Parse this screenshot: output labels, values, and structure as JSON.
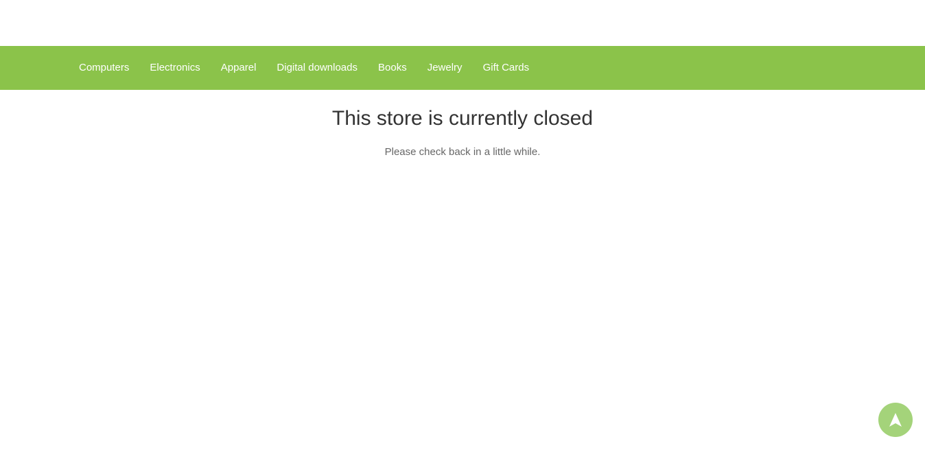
{
  "nav": {
    "items": [
      {
        "label": "Computers"
      },
      {
        "label": "Electronics"
      },
      {
        "label": "Apparel"
      },
      {
        "label": "Digital downloads"
      },
      {
        "label": "Books"
      },
      {
        "label": "Jewelry"
      },
      {
        "label": "Gift Cards"
      }
    ]
  },
  "main": {
    "title": "This store is currently closed",
    "message": "Please check back in a little while."
  },
  "scroll_top": {
    "icon": "arrow-up-icon"
  },
  "colors": {
    "nav_background": "#8bc34a",
    "scroll_button": "#a4d37a"
  }
}
